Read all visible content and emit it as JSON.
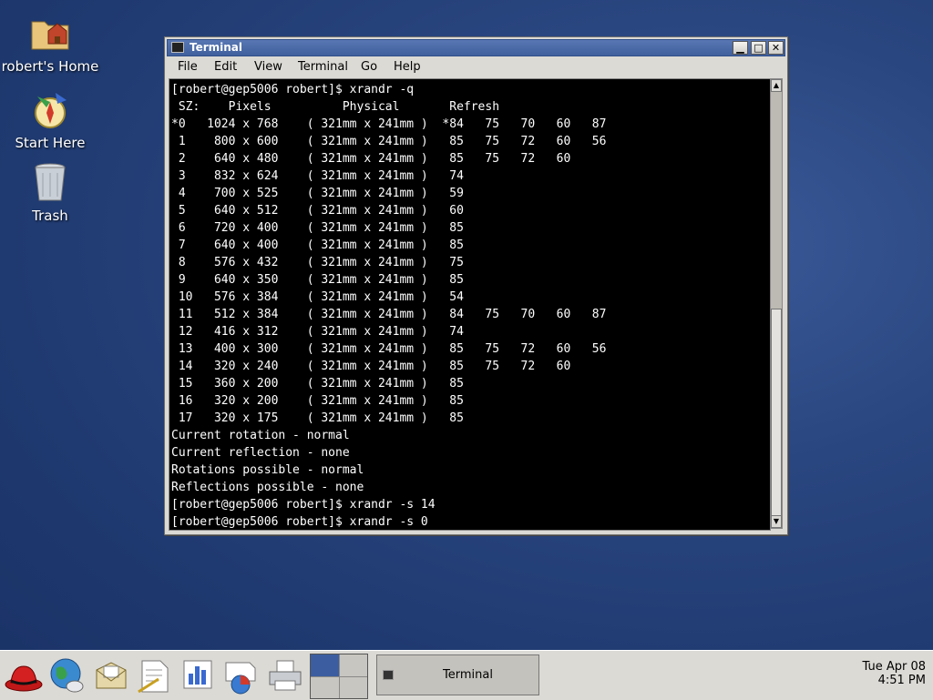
{
  "desktop": {
    "icons": [
      {
        "label": "robert's Home"
      },
      {
        "label": "Start Here"
      },
      {
        "label": "Trash"
      }
    ]
  },
  "window": {
    "title": "Terminal",
    "menu": [
      "File",
      "Edit",
      "View",
      "Terminal",
      "Go",
      "Help"
    ],
    "terminal_lines": [
      "[robert@gep5006 robert]$ xrandr -q",
      " SZ:    Pixels          Physical       Refresh",
      "*0   1024 x 768    ( 321mm x 241mm )  *84   75   70   60   87",
      " 1    800 x 600    ( 321mm x 241mm )   85   75   72   60   56",
      " 2    640 x 480    ( 321mm x 241mm )   85   75   72   60",
      " 3    832 x 624    ( 321mm x 241mm )   74",
      " 4    700 x 525    ( 321mm x 241mm )   59",
      " 5    640 x 512    ( 321mm x 241mm )   60",
      " 6    720 x 400    ( 321mm x 241mm )   85",
      " 7    640 x 400    ( 321mm x 241mm )   85",
      " 8    576 x 432    ( 321mm x 241mm )   75",
      " 9    640 x 350    ( 321mm x 241mm )   85",
      " 10   576 x 384    ( 321mm x 241mm )   54",
      " 11   512 x 384    ( 321mm x 241mm )   84   75   70   60   87",
      " 12   416 x 312    ( 321mm x 241mm )   74",
      " 13   400 x 300    ( 321mm x 241mm )   85   75   72   60   56",
      " 14   320 x 240    ( 321mm x 241mm )   85   75   72   60",
      " 15   360 x 200    ( 321mm x 241mm )   85",
      " 16   320 x 200    ( 321mm x 241mm )   85",
      " 17   320 x 175    ( 321mm x 241mm )   85",
      "Current rotation - normal",
      "Current reflection - none",
      "Rotations possible - normal",
      "Reflections possible - none",
      "[robert@gep5006 robert]$ xrandr -s 14",
      "[robert@gep5006 robert]$ xrandr -s 0"
    ]
  },
  "panel": {
    "task_label": "Terminal",
    "clock_date": "Tue Apr 08",
    "clock_time": "4:51 PM"
  }
}
